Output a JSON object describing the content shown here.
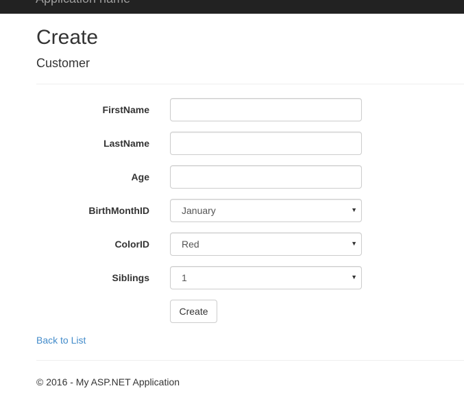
{
  "navbar": {
    "brand": "Application name"
  },
  "page": {
    "title": "Create",
    "subtitle": "Customer"
  },
  "form": {
    "fields": [
      {
        "label": "FirstName",
        "type": "text",
        "value": ""
      },
      {
        "label": "LastName",
        "type": "text",
        "value": ""
      },
      {
        "label": "Age",
        "type": "text",
        "value": ""
      },
      {
        "label": "BirthMonthID",
        "type": "select",
        "value": "January"
      },
      {
        "label": "ColorID",
        "type": "select",
        "value": "Red"
      },
      {
        "label": "Siblings",
        "type": "select",
        "value": "1"
      }
    ],
    "submit_label": "Create"
  },
  "links": {
    "back": "Back to List"
  },
  "footer": {
    "text": "© 2016 - My ASP.NET Application"
  },
  "icons": {
    "dropdown_caret": "▼"
  }
}
